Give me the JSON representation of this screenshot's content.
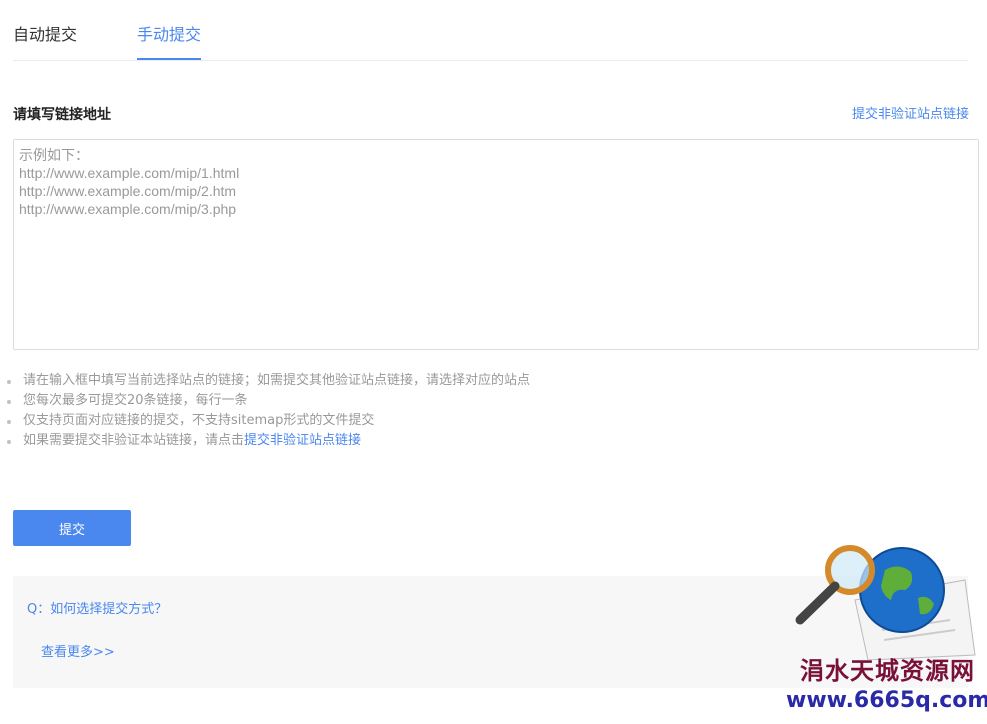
{
  "tabs": [
    {
      "label": "自动提交",
      "active": false
    },
    {
      "label": "手动提交",
      "active": true
    }
  ],
  "form": {
    "title": "请填写链接地址",
    "top_link": "提交非验证站点链接",
    "placeholder": "示例如下：\nhttp://www.example.com/mip/1.html\nhttp://www.example.com/mip/2.htm\nhttp://www.example.com/mip/3.php",
    "value": ""
  },
  "tips": {
    "t1": "请在输入框中填写当前选择站点的链接；如需提交其他验证站点链接，请选择对应的站点",
    "t2": "您每次最多可提交20条链接，每行一条",
    "t3": "仅支持页面对应链接的提交，不支持sitemap形式的文件提交",
    "t4_prefix": "如果需要提交非验证本站链接，请点击",
    "t4_link": "提交非验证站点链接"
  },
  "submit_label": "提交",
  "faq": {
    "question": "Q：如何选择提交方式？",
    "more": "查看更多>>"
  },
  "watermark": {
    "text": "涓水天城资源网",
    "url": "www.6665q.com"
  },
  "colors": {
    "accent": "#4a87ee",
    "watermark_text": "#7a1038",
    "watermark_url": "#2a2aa8"
  },
  "icons": [
    "magnifier-globe-icon"
  ]
}
